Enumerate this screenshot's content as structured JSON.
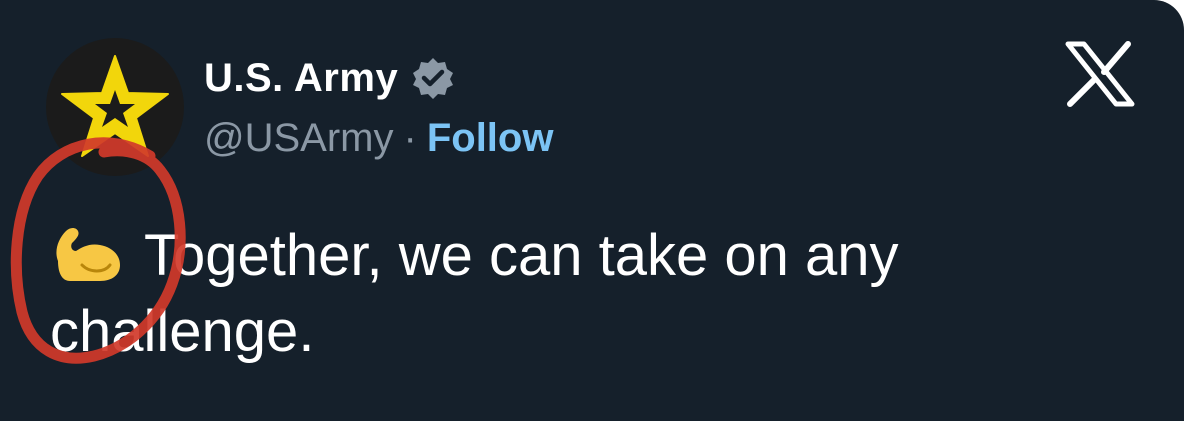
{
  "tweet": {
    "display_name": "U.S. Army",
    "handle": "@USArmy",
    "separator": "·",
    "follow_label": "Follow",
    "text": "Together, we can take on any challenge.",
    "emoji": "flexed-biceps"
  },
  "icons": {
    "avatar": "army-star-logo",
    "verified": "verified-badge-icon",
    "close": "x-logo-icon"
  },
  "colors": {
    "background": "#15202b",
    "name": "#ffffff",
    "handle": "#8b98a5",
    "follow": "#7cc4f5",
    "verified_badge": "#8b98a5",
    "annotation_circle": "#d13a2a"
  }
}
